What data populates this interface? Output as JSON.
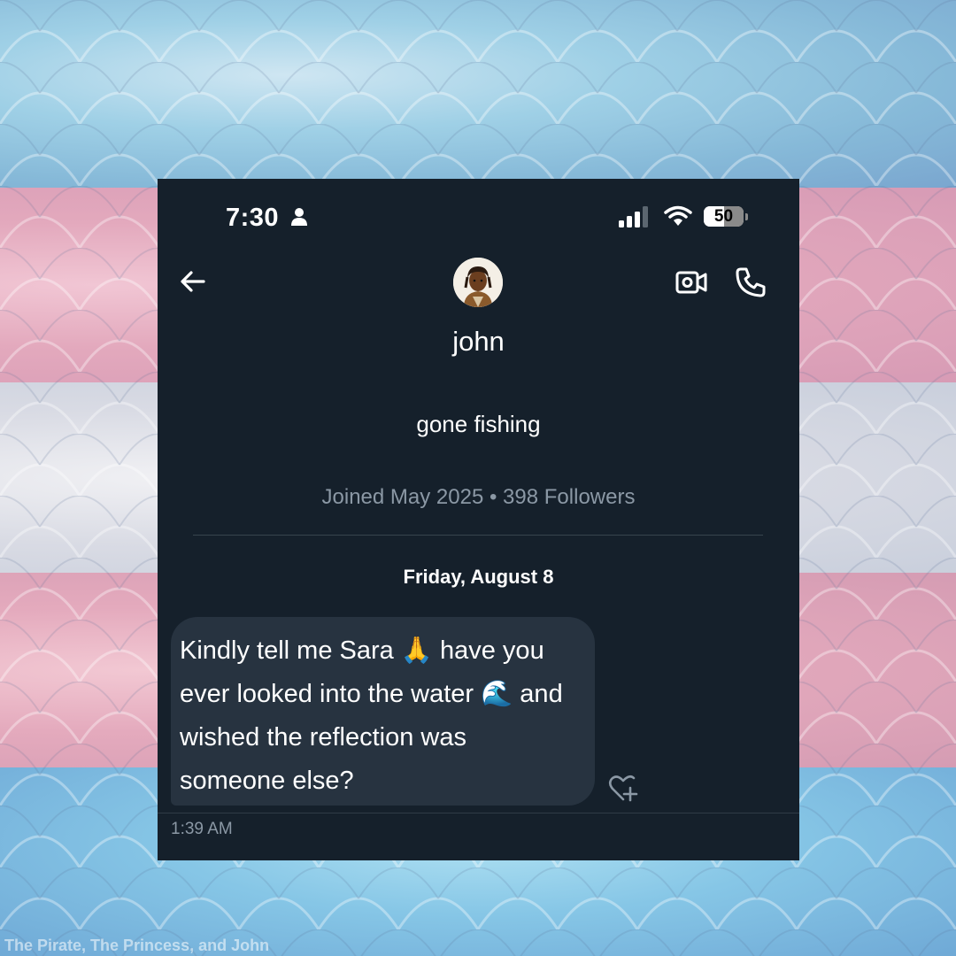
{
  "status_bar": {
    "time": "7:30",
    "battery": "50",
    "battery_level": 0.5,
    "signal_icon": "cellular-signal-icon",
    "wifi_icon": "wifi-icon",
    "person_icon": "person-icon"
  },
  "header": {
    "back_icon": "arrow-left-icon",
    "video_icon": "video-camera-icon",
    "call_icon": "phone-icon",
    "name": "john"
  },
  "profile": {
    "bio": "gone fishing",
    "meta": "Joined May 2025 • 398 Followers"
  },
  "conversation": {
    "date_separator": "Friday, August 8",
    "messages": [
      {
        "text": "Kindly tell me Sara 🙏 have you\never looked into the water 🌊 and\nwished the reflection was\nsomeone else?",
        "timestamp": "1:39 AM"
      }
    ],
    "react_icon": "heart-plus-icon"
  },
  "watermark": "The Pirate, The Princess, and John",
  "colors": {
    "app_background": "#15202b",
    "bubble": "#273340",
    "secondary_text": "#8b98a5",
    "flag_blue": "#86c6e6",
    "flag_pink": "#e3a9bd",
    "flag_white": "#e6e7ec"
  }
}
